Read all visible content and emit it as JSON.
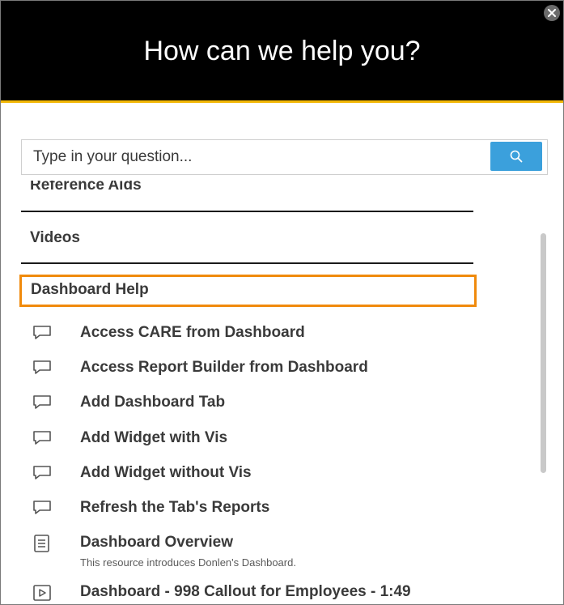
{
  "header": {
    "title": "How can we help you?"
  },
  "search": {
    "placeholder": "Type in your question..."
  },
  "sections": {
    "reference_aids": "Reference Aids",
    "videos": "Videos",
    "dashboard_help": "Dashboard Help"
  },
  "items": [
    {
      "label": "Access CARE from Dashboard",
      "icon": "chat-bubble-icon"
    },
    {
      "label": "Access Report Builder from Dashboard",
      "icon": "chat-bubble-icon"
    },
    {
      "label": "Add Dashboard Tab",
      "icon": "chat-bubble-icon"
    },
    {
      "label": "Add Widget with Vis",
      "icon": "chat-bubble-icon"
    },
    {
      "label": "Add Widget without Vis",
      "icon": "chat-bubble-icon"
    },
    {
      "label": "Refresh the Tab's Reports",
      "icon": "chat-bubble-icon"
    },
    {
      "label": "Dashboard Overview",
      "description": "This resource introduces Donlen's Dashboard.",
      "icon": "document-icon"
    },
    {
      "label": "Dashboard - 998 Callout for Employees - 1:49",
      "icon": "video-play-icon"
    }
  ],
  "colors": {
    "header_bg": "#000000",
    "accent_line": "#f2b705",
    "search_button": "#3ba0dc",
    "focus_outline": "#f08a0c",
    "text": "#3a3a3a"
  }
}
